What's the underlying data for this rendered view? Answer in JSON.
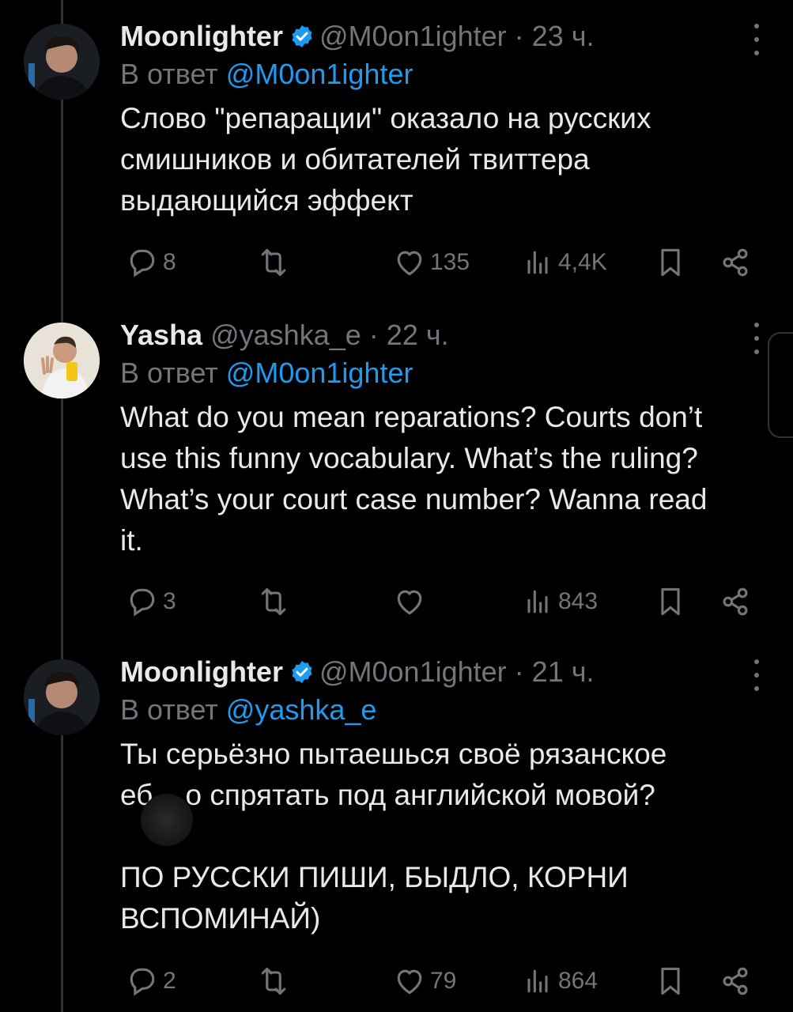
{
  "tweets": [
    {
      "name": "Moonlighter",
      "verified": true,
      "handle": "@M0on1ighter",
      "sep": "·",
      "time": "23 ч.",
      "reply_prefix": "В ответ ",
      "reply_to": "@M0on1ighter",
      "text": "Слово \"репарации\" оказало на русских\nсмишников и обитателей твиттера\nвыдающийся эффект",
      "replies": "8",
      "retweets": "",
      "likes": "135",
      "views": "4,4K"
    },
    {
      "name": "Yasha",
      "verified": false,
      "handle": "@yashka_e",
      "sep": "·",
      "time": "22 ч.",
      "reply_prefix": "В ответ ",
      "reply_to": "@M0on1ighter",
      "text": "What do you mean reparations? Courts don’t\nuse this funny vocabulary. What’s the ruling?\nWhat’s your court case number? Wanna read\nit.",
      "replies": "3",
      "retweets": "",
      "likes": "",
      "views": "843"
    },
    {
      "name": "Moonlighter",
      "verified": true,
      "handle": "@M0on1ighter",
      "sep": "·",
      "time": "21 ч.",
      "reply_prefix": "В ответ ",
      "reply_to": "@yashka_e",
      "text": "Ты серьёзно пытаешься своё рязанское\nеб    о спрятать под английской мовой?\n\nПО РУССКИ ПИШИ, БЫДЛО, КОРНИ\nВСПОМИНАЙ)",
      "replies": "2",
      "retweets": "",
      "likes": "79",
      "views": "864"
    }
  ],
  "colors": {
    "background": "#000000",
    "text": "#e7e9ea",
    "muted": "#71767b",
    "link": "#1d9bf0",
    "verified": "#1d9bf0"
  },
  "icons": [
    "reply-icon",
    "retweet-icon",
    "like-icon",
    "views-icon",
    "bookmark-icon",
    "share-icon",
    "more-icon",
    "verified-badge-icon"
  ]
}
